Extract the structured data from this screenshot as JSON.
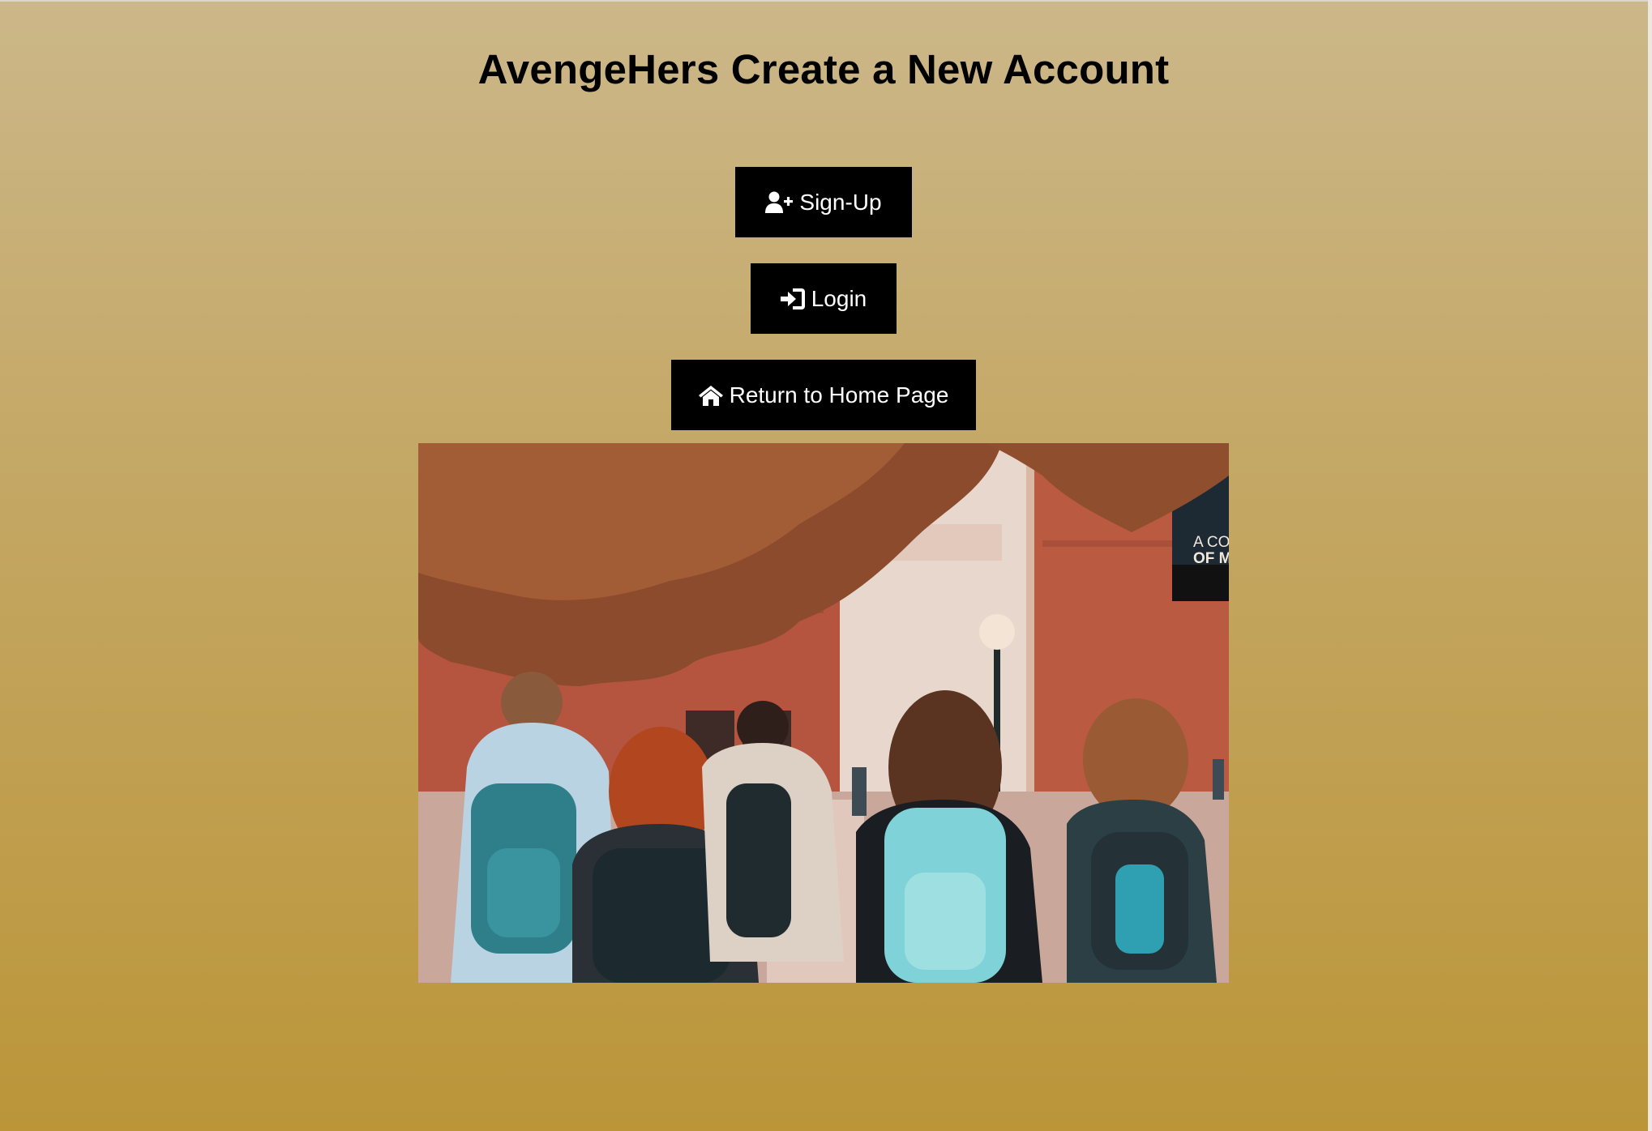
{
  "page": {
    "title": "AvengeHers Create a New Account"
  },
  "buttons": {
    "signup_label": "Sign-Up",
    "login_label": "Login",
    "home_label": "Return to Home Page",
    "signup_icon": "user-plus-icon",
    "login_icon": "sign-in-icon",
    "home_icon": "home-icon"
  },
  "photo": {
    "banner_text_line1": "A CO",
    "banner_text_line2": "OF M"
  },
  "colors": {
    "background_top": "#ccb789",
    "background_bottom": "#bb9538",
    "button_bg": "#000000",
    "button_text": "#ffffff"
  }
}
